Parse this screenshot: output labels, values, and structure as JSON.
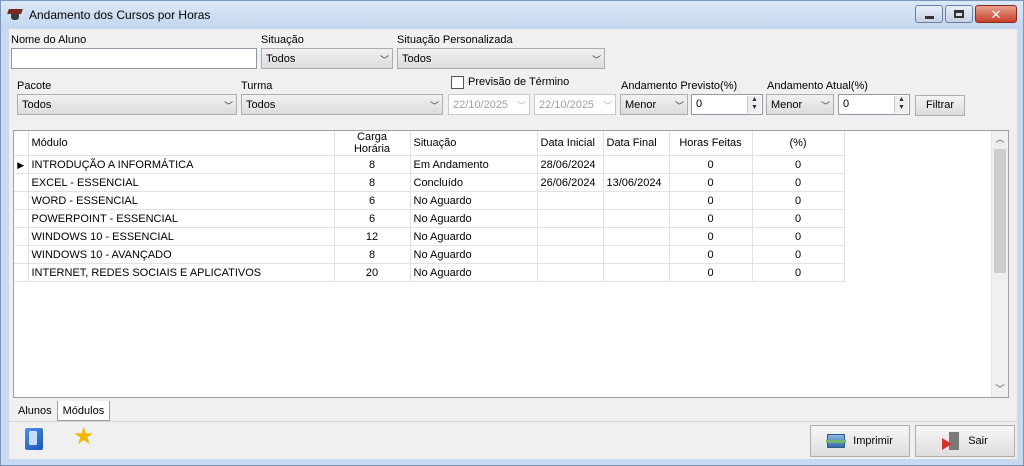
{
  "window": {
    "title": "Andamento dos Cursos por Horas"
  },
  "filters": {
    "nome_aluno": {
      "label": "Nome do Aluno",
      "value": ""
    },
    "situacao": {
      "label": "Situação",
      "value": "Todos"
    },
    "situacao_personalizada": {
      "label": "Situação Personalizada",
      "value": "Todos"
    },
    "pacote": {
      "label": "Pacote",
      "value": "Todos"
    },
    "turma": {
      "label": "Turma",
      "value": "Todos"
    },
    "previsao_termino": {
      "label": "Previsão de Término",
      "checked": false,
      "date_from": "22/10/2025",
      "date_to": "22/10/2025"
    },
    "andamento_previsto": {
      "label": "Andamento Previsto(%)",
      "operator": "Menor",
      "value": "0"
    },
    "andamento_atual": {
      "label": "Andamento Atual(%)",
      "operator": "Menor",
      "value": "0"
    },
    "filtrar_label": "Filtrar"
  },
  "grid": {
    "columns": [
      "Módulo",
      "Carga Horária",
      "Situação",
      "Data Inicial",
      "Data Final",
      "Horas Feitas",
      "(%)"
    ],
    "rows": [
      [
        "INTRODUÇÃO A INFORMÁTICA",
        "8",
        "Em Andamento",
        "28/06/2024",
        "",
        "0",
        "0"
      ],
      [
        "EXCEL - ESSENCIAL",
        "8",
        "Concluído",
        "26/06/2024",
        "13/06/2024",
        "0",
        "0"
      ],
      [
        "WORD - ESSENCIAL",
        "6",
        "No Aguardo",
        "",
        "",
        "0",
        "0"
      ],
      [
        "POWERPOINT - ESSENCIAL",
        "6",
        "No Aguardo",
        "",
        "",
        "0",
        "0"
      ],
      [
        "WINDOWS 10 - ESSENCIAL",
        "12",
        "No Aguardo",
        "",
        "",
        "0",
        "0"
      ],
      [
        "WINDOWS 10 - AVANÇADO",
        "8",
        "No Aguardo",
        "",
        "",
        "0",
        "0"
      ],
      [
        "INTERNET, REDES SOCIAIS E APLICATIVOS",
        "20",
        "No Aguardo",
        "",
        "",
        "0",
        "0"
      ]
    ],
    "current_row": 0
  },
  "tabs": [
    {
      "label": "Alunos",
      "active": false
    },
    {
      "label": "Módulos",
      "active": true
    }
  ],
  "footer": {
    "imprimir_label": "Imprimir",
    "sair_label": "Sair"
  },
  "icons": [
    "app-icon",
    "minimize-icon",
    "maximize-icon",
    "close-icon",
    "book-icon",
    "star-icon",
    "printer-icon",
    "exit-icon"
  ]
}
